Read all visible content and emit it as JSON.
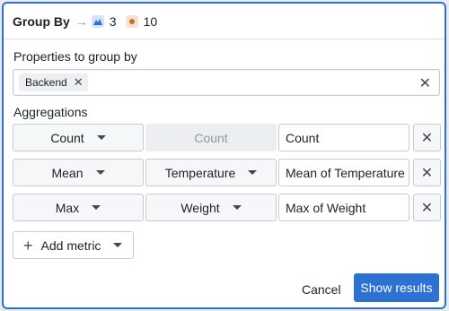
{
  "header": {
    "title": "Group By",
    "arrow": "→",
    "objects_count": "3",
    "values_count": "10"
  },
  "group_by": {
    "label": "Properties to group by",
    "tags": [
      "Backend"
    ],
    "tag_remove": "✕",
    "clear": "✕"
  },
  "aggregations": {
    "label": "Aggregations",
    "rows": [
      {
        "function": "Count",
        "property": "Count",
        "property_disabled": true,
        "name": "Count",
        "remove": "✕"
      },
      {
        "function": "Mean",
        "property": "Temperature",
        "property_disabled": false,
        "name": "Mean of Temperature",
        "remove": "✕"
      },
      {
        "function": "Max",
        "property": "Weight",
        "property_disabled": false,
        "name": "Max of Weight",
        "remove": "✕"
      }
    ]
  },
  "add_metric": {
    "icon": "+",
    "label": "Add metric"
  },
  "footer": {
    "cancel": "Cancel",
    "submit": "Show results"
  },
  "colors": {
    "accent": "#2d72d2",
    "object_icon": "#2d72d2",
    "value_dot": "#c87619"
  }
}
